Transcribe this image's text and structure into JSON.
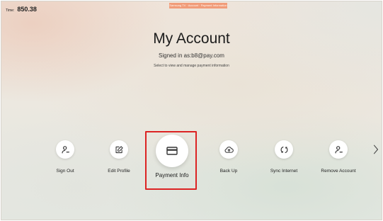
{
  "status": {
    "timer_label": "Time:",
    "timer_value": "850.38",
    "banner_text": "Samsung TV · Account · Payment Information"
  },
  "header": {
    "title": "My Account",
    "signed_in": "Signed in as:b8@pay.com",
    "hint": "Select to view and manage payment information"
  },
  "menu": {
    "items": [
      {
        "label": "Sign Out",
        "icon": "person-minus-icon"
      },
      {
        "label": "Edit Profile",
        "icon": "edit-icon"
      },
      {
        "label": "Payment Info",
        "icon": "credit-card-icon",
        "focused": true
      },
      {
        "label": "Back Up",
        "icon": "cloud-upload-icon"
      },
      {
        "label": "Sync Internet",
        "icon": "sync-icon"
      },
      {
        "label": "Remove Account",
        "icon": "person-minus-icon"
      }
    ],
    "next_icon": "chevron-right-icon"
  },
  "colors": {
    "focus_border": "#dc2323",
    "banner": "#f19c79"
  }
}
